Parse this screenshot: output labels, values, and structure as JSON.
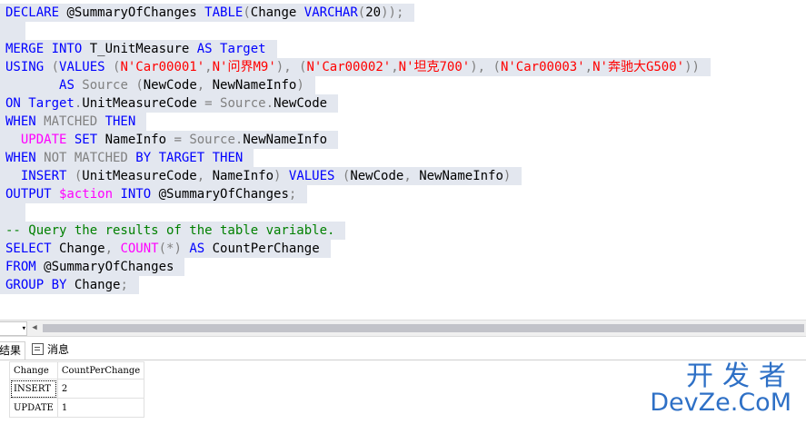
{
  "editor": {
    "lines": [
      [
        {
          "t": "DECLARE",
          "c": "kw"
        },
        {
          "t": " @SummaryOfChanges ",
          "c": ""
        },
        {
          "t": "TABLE",
          "c": "kw"
        },
        {
          "t": "(",
          "c": "gry"
        },
        {
          "t": "Change ",
          "c": ""
        },
        {
          "t": "VARCHAR",
          "c": "kw"
        },
        {
          "t": "(",
          "c": "gry"
        },
        {
          "t": "20",
          "c": ""
        },
        {
          "t": "));",
          "c": "gry"
        }
      ],
      [],
      [
        {
          "t": "MERGE INTO",
          "c": "kw"
        },
        {
          "t": " T_UnitMeasure ",
          "c": ""
        },
        {
          "t": "AS",
          "c": "kw"
        },
        {
          "t": " Target",
          "c": "kw"
        }
      ],
      [
        {
          "t": "USING",
          "c": "kw"
        },
        {
          "t": " (",
          "c": "gry"
        },
        {
          "t": "VALUES",
          "c": "kw"
        },
        {
          "t": " (",
          "c": "gry"
        },
        {
          "t": "N'Car00001'",
          "c": "str"
        },
        {
          "t": ",",
          "c": "gry"
        },
        {
          "t": "N'问界M9'",
          "c": "str"
        },
        {
          "t": "), (",
          "c": "gry"
        },
        {
          "t": "N'Car00002'",
          "c": "str"
        },
        {
          "t": ",",
          "c": "gry"
        },
        {
          "t": "N'坦克700'",
          "c": "str"
        },
        {
          "t": "), (",
          "c": "gry"
        },
        {
          "t": "N'Car00003'",
          "c": "str"
        },
        {
          "t": ",",
          "c": "gry"
        },
        {
          "t": "N'奔驰大G500'",
          "c": "str"
        },
        {
          "t": "))",
          "c": "gry"
        }
      ],
      [
        {
          "t": "       ",
          "c": ""
        },
        {
          "t": "AS",
          "c": "kw"
        },
        {
          "t": " Source ",
          "c": "gry"
        },
        {
          "t": "(",
          "c": "gry"
        },
        {
          "t": "NewCode",
          "c": ""
        },
        {
          "t": ", ",
          "c": "gry"
        },
        {
          "t": "NewNameInfo",
          "c": ""
        },
        {
          "t": ")",
          "c": "gry"
        }
      ],
      [
        {
          "t": "ON",
          "c": "kw"
        },
        {
          "t": " Target",
          "c": "kw"
        },
        {
          "t": ".",
          "c": "gry"
        },
        {
          "t": "UnitMeasureCode ",
          "c": ""
        },
        {
          "t": "=",
          "c": "gry"
        },
        {
          "t": " Source",
          "c": "gry"
        },
        {
          "t": ".",
          "c": "gry"
        },
        {
          "t": "NewCode",
          "c": ""
        }
      ],
      [
        {
          "t": "WHEN",
          "c": "kw"
        },
        {
          "t": " MATCHED ",
          "c": "gry"
        },
        {
          "t": "THEN",
          "c": "kw"
        }
      ],
      [
        {
          "t": "  ",
          "c": ""
        },
        {
          "t": "UPDATE",
          "c": "fn"
        },
        {
          "t": " SET",
          "c": "kw"
        },
        {
          "t": " NameInfo ",
          "c": ""
        },
        {
          "t": "=",
          "c": "gry"
        },
        {
          "t": " Source",
          "c": "gry"
        },
        {
          "t": ".",
          "c": "gry"
        },
        {
          "t": "NewNameInfo",
          "c": ""
        }
      ],
      [
        {
          "t": "WHEN",
          "c": "kw"
        },
        {
          "t": " NOT MATCHED ",
          "c": "gry"
        },
        {
          "t": "BY TARGET THEN",
          "c": "kw"
        }
      ],
      [
        {
          "t": "  ",
          "c": ""
        },
        {
          "t": "INSERT",
          "c": "kw"
        },
        {
          "t": " (",
          "c": "gry"
        },
        {
          "t": "UnitMeasureCode",
          "c": ""
        },
        {
          "t": ", ",
          "c": "gry"
        },
        {
          "t": "NameInfo",
          "c": ""
        },
        {
          "t": ") ",
          "c": "gry"
        },
        {
          "t": "VALUES",
          "c": "kw"
        },
        {
          "t": " (",
          "c": "gry"
        },
        {
          "t": "NewCode",
          "c": ""
        },
        {
          "t": ", ",
          "c": "gry"
        },
        {
          "t": "NewNameInfo",
          "c": ""
        },
        {
          "t": ")",
          "c": "gry"
        }
      ],
      [
        {
          "t": "OUTPUT",
          "c": "kw"
        },
        {
          "t": " $action",
          "c": "var"
        },
        {
          "t": " INTO",
          "c": "kw"
        },
        {
          "t": " @SummaryOfChanges",
          "c": ""
        },
        {
          "t": ";",
          "c": "gry"
        }
      ],
      [],
      [
        {
          "t": "-- Query the results of the table variable.",
          "c": "cmt"
        }
      ],
      [
        {
          "t": "SELECT",
          "c": "kw"
        },
        {
          "t": " Change",
          "c": ""
        },
        {
          "t": ", ",
          "c": "gry"
        },
        {
          "t": "COUNT",
          "c": "fn"
        },
        {
          "t": "(*)",
          "c": "gry"
        },
        {
          "t": " AS",
          "c": "kw"
        },
        {
          "t": " CountPerChange",
          "c": ""
        }
      ],
      [
        {
          "t": "FROM",
          "c": "kw"
        },
        {
          "t": " @SummaryOfChanges",
          "c": ""
        }
      ],
      [
        {
          "t": "GROUP BY",
          "c": "kw"
        },
        {
          "t": " Change",
          "c": ""
        },
        {
          "t": ";",
          "c": "gry"
        }
      ]
    ]
  },
  "scrollbar": {
    "zoom_label": "▾",
    "left_arrow": "◀"
  },
  "tabs": {
    "results": "结果",
    "messages": "消息"
  },
  "results": {
    "columns": [
      "Change",
      "CountPerChange"
    ],
    "rows": [
      [
        "INSERT",
        "2"
      ],
      [
        "UPDATE",
        "1"
      ]
    ]
  },
  "watermark": {
    "cn": "开发者",
    "en": "DevZe.CoM"
  },
  "colors": {
    "keyword": "#0000ff",
    "function": "#ff00ff",
    "string": "#ff0000",
    "comment": "#008000",
    "operator": "#808080",
    "selection": "#e3e7ef",
    "watermark": "#2e70c6"
  }
}
